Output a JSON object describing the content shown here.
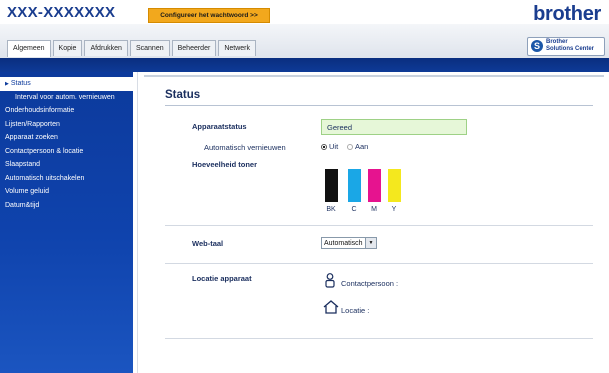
{
  "header": {
    "model_name": "XXX-XXXXXXX",
    "password_button": "Configureer het wachtwoord >>",
    "brand_logo": "brother",
    "solutions_center": {
      "line1": "Brother",
      "line2": "Solutions Center"
    }
  },
  "tabs": [
    {
      "label": "Algemeen",
      "active": true
    },
    {
      "label": "Kopie"
    },
    {
      "label": "Afdrukken"
    },
    {
      "label": "Scannen"
    },
    {
      "label": "Beheerder"
    },
    {
      "label": "Netwerk"
    }
  ],
  "sidebar": {
    "items": [
      {
        "label": "Status",
        "active": true
      },
      {
        "label": "Interval voor autom. vernieuwen",
        "sub": true
      },
      {
        "label": "Onderhoudsinformatie"
      },
      {
        "label": "Lijsten/Rapporten"
      },
      {
        "label": "Apparaat zoeken"
      },
      {
        "label": "Contactpersoon & locatie"
      },
      {
        "label": "Slaapstand"
      },
      {
        "label": "Automatisch uitschakelen"
      },
      {
        "label": "Volume geluid"
      },
      {
        "label": "Datum&tijd"
      }
    ]
  },
  "main": {
    "title": "Status",
    "device_status_label": "Apparaatstatus",
    "device_status_value": "Gereed",
    "auto_refresh_label": "Automatisch vernieuwen",
    "auto_refresh_options": [
      "Uit",
      "Aan"
    ],
    "auto_refresh_selected": "Uit",
    "toner_label": "Hoeveelheid toner",
    "toners": [
      {
        "name": "BK",
        "color": "#111111",
        "level": 1.0
      },
      {
        "name": "C",
        "color": "#1aa7e6",
        "level": 1.0
      },
      {
        "name": "M",
        "color": "#e6138f",
        "level": 1.0
      },
      {
        "name": "Y",
        "color": "#f4e81e",
        "level": 1.0
      }
    ],
    "web_language_label": "Web-taal",
    "web_language_value": "Automatisch",
    "location_label": "Locatie apparaat",
    "contact_label": "Contactpersoon :",
    "location_text": "Locatie :"
  },
  "colors": {
    "brand_blue": "#1a3d8f",
    "sidebar_blue": "#0c3a9c",
    "password_button_orange": "#f2a81d"
  }
}
